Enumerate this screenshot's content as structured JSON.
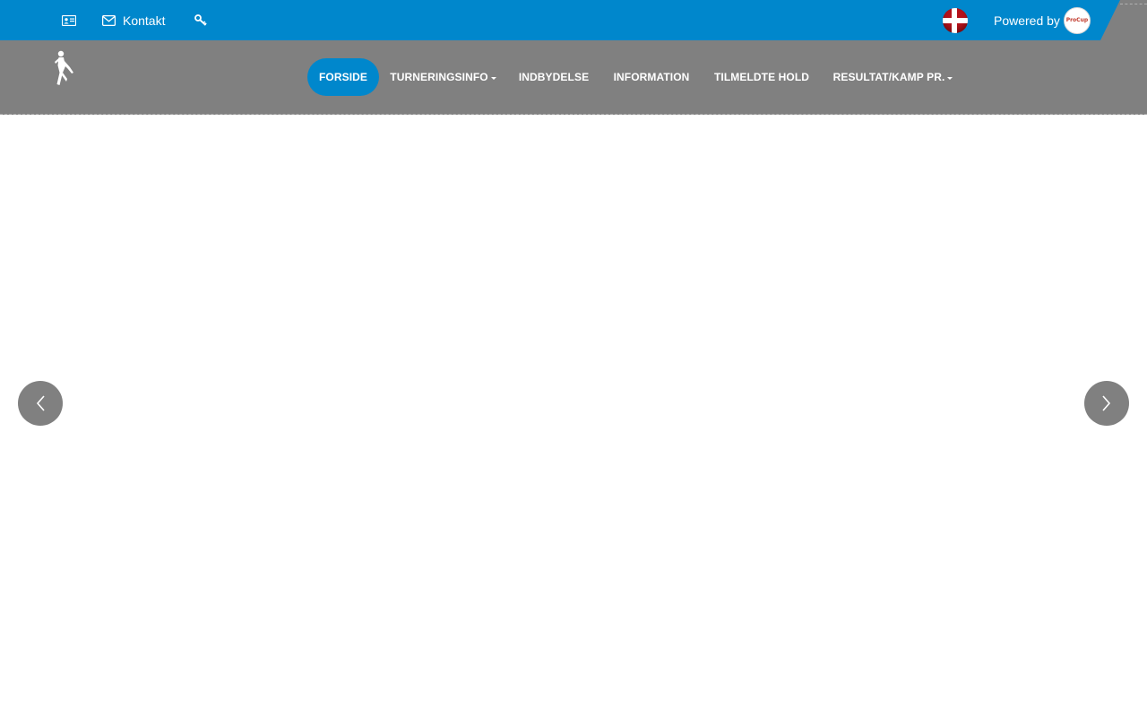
{
  "topbar": {
    "items": [
      {
        "name": "id-card-icon"
      },
      {
        "name": "envelope-icon",
        "label": "Kontakt"
      },
      {
        "name": "key-icon"
      }
    ],
    "language_flag": "danish-flag-icon",
    "powered_by": "Powered by",
    "powered_logo_text": "ProCup"
  },
  "nav": {
    "items": [
      {
        "label": "FORSIDE",
        "active": true
      },
      {
        "label": "TURNERINGSINFO",
        "dropdown": true
      },
      {
        "label": "INDBYDELSE"
      },
      {
        "label": "INFORMATION"
      },
      {
        "label": "TILMELDTE HOLD"
      },
      {
        "label": "RESULTAT/KAMP PR.",
        "dropdown": true
      }
    ]
  },
  "colors": {
    "primary": "#0087cc",
    "navbar": "#808080",
    "background": "#ffffff"
  }
}
